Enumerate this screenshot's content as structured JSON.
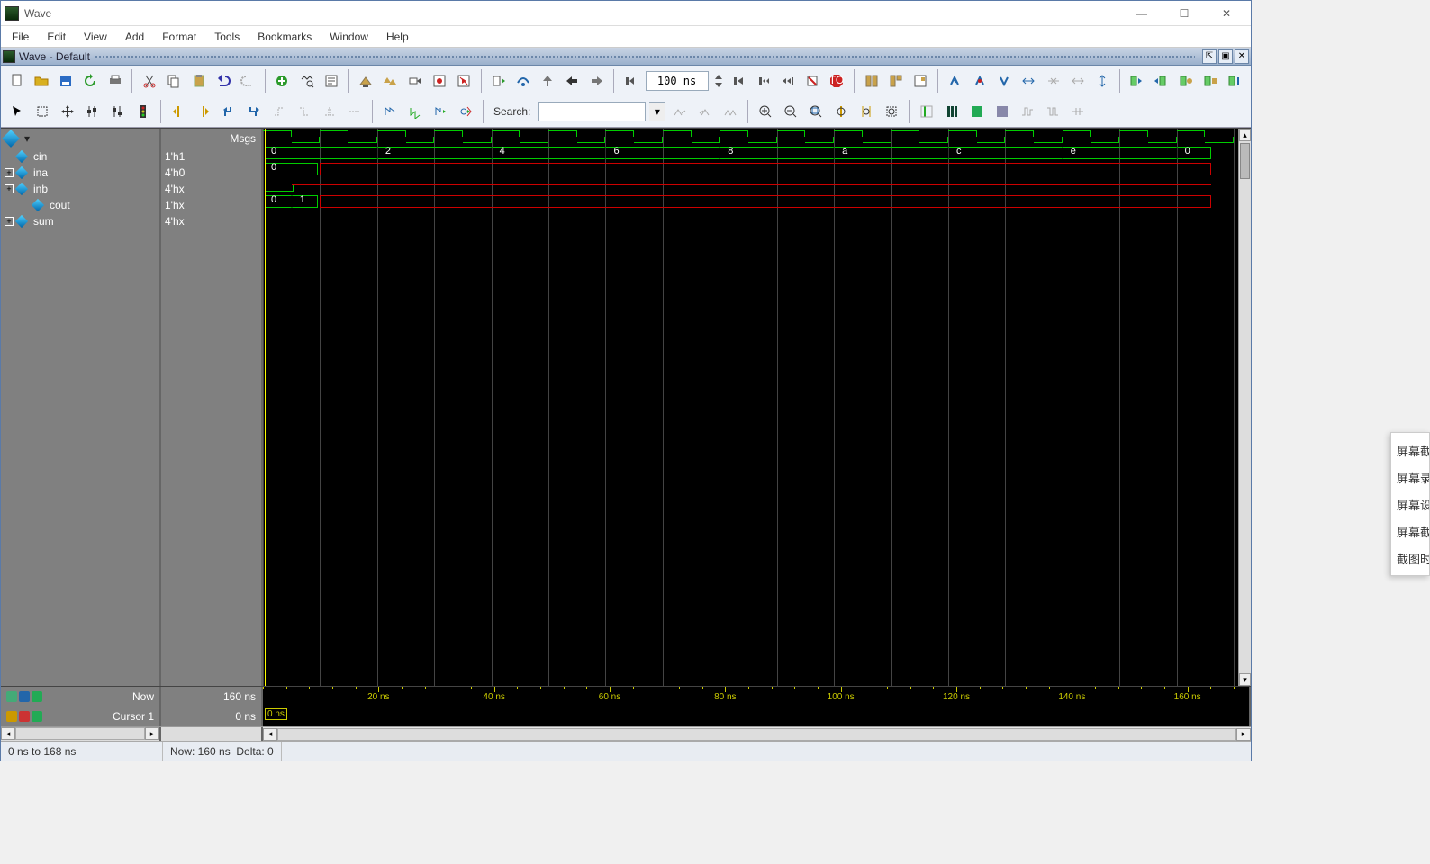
{
  "window": {
    "title": "Wave"
  },
  "menu": {
    "items": [
      "File",
      "Edit",
      "View",
      "Add",
      "Format",
      "Tools",
      "Bookmarks",
      "Window",
      "Help"
    ]
  },
  "tab": {
    "label": "Wave - Default"
  },
  "toolbar": {
    "time_value": "100 ns",
    "search_label": "Search:",
    "search_value": ""
  },
  "panes": {
    "msgs_header": "Msgs",
    "signals": [
      {
        "name": "cin",
        "value": "1'h1",
        "expandable": false,
        "indent": 0
      },
      {
        "name": "ina",
        "value": "4'h0",
        "expandable": true,
        "indent": 0
      },
      {
        "name": "inb",
        "value": "4'hx",
        "expandable": true,
        "indent": 0
      },
      {
        "name": "cout",
        "value": "1'hx",
        "expandable": false,
        "indent": 1
      },
      {
        "name": "sum",
        "value": "4'hx",
        "expandable": true,
        "indent": 0
      }
    ]
  },
  "wave": {
    "bus_labels_ina": [
      "0",
      "2",
      "4",
      "6",
      "8",
      "a",
      "c",
      "e",
      "0"
    ],
    "bus_labels_inb": [
      "0"
    ],
    "bus_labels_sum": [
      "0",
      "1"
    ],
    "grid_count": 17
  },
  "footer": {
    "now_label": "Now",
    "now_value": "160 ns",
    "cursor_label": "Cursor 1",
    "cursor_value": "0 ns",
    "cursor_box": "0 ns",
    "ruler_ticks": [
      "20 ns",
      "40 ns",
      "60 ns",
      "80 ns",
      "100 ns",
      "120 ns",
      "140 ns",
      "160 ns"
    ]
  },
  "status": {
    "range": "0 ns to 168 ns",
    "now": "Now: 160 ns",
    "delta": "Delta: 0"
  },
  "context_menu": {
    "items": [
      "屏幕截",
      "屏幕录",
      "屏幕设",
      "屏幕截",
      "截图时"
    ]
  }
}
